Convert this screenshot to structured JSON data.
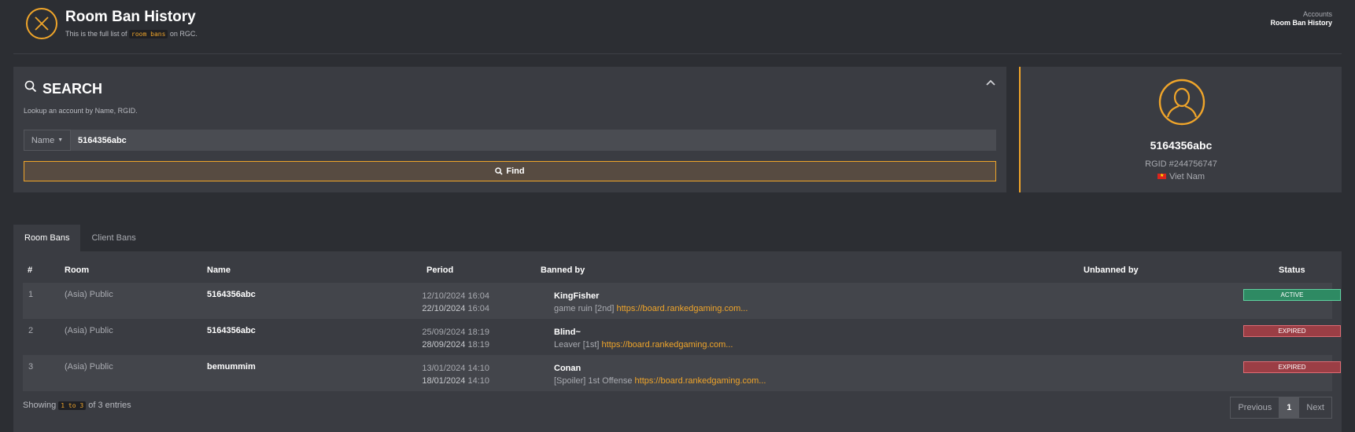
{
  "header": {
    "title": "Room Ban History",
    "subtitle_prefix": "This is the full list of",
    "subtitle_code": "room bans",
    "subtitle_suffix": "on RGC.",
    "breadcrumb_parent": "Accounts",
    "breadcrumb_current": "Room Ban History",
    "icon": "close-circle-icon"
  },
  "search": {
    "title": "SEARCH",
    "hint": "Lookup an account by Name, RGID.",
    "field_selected": "Name",
    "value": "5164356abc",
    "find_label": "Find"
  },
  "profile": {
    "name": "5164356abc",
    "rgid": "RGID #244756747",
    "country": "Viet Nam"
  },
  "tabs": [
    {
      "label": "Room Bans",
      "active": true
    },
    {
      "label": "Client Bans",
      "active": false
    }
  ],
  "table": {
    "headers": {
      "num": "#",
      "room": "Room",
      "name": "Name",
      "period": "Period",
      "banned_by": "Banned by",
      "unbanned_by": "Unbanned by",
      "status": "Status"
    },
    "rows": [
      {
        "num": "1",
        "room": "(Asia) Public",
        "name": "5164356abc",
        "start_date": "12/10/2024",
        "start_time": "16:04",
        "end_date": "22/10/2024",
        "end_time": "16:04",
        "banned_by": "KingFisher",
        "reason": "game ruin [2nd]",
        "link": "https://board.rankedgaming.com...",
        "status": "ACTIVE"
      },
      {
        "num": "2",
        "room": "(Asia) Public",
        "name": "5164356abc",
        "start_date": "25/09/2024",
        "start_time": "18:19",
        "end_date": "28/09/2024",
        "end_time": "18:19",
        "banned_by": "Blind~",
        "reason": "Leaver [1st]",
        "link": "https://board.rankedgaming.com...",
        "status": "EXPIRED"
      },
      {
        "num": "3",
        "room": "(Asia) Public",
        "name": "bemummim",
        "start_date": "13/01/2024",
        "start_time": "14:10",
        "end_date": "18/01/2024",
        "end_time": "14:10",
        "banned_by": "Conan",
        "reason": "[Spoiler] 1st Offense",
        "link": "https://board.rankedgaming.com...",
        "status": "EXPIRED"
      }
    ],
    "footer_prefix": "Showing",
    "footer_range": "1 to 3",
    "footer_suffix": "of 3 entries"
  },
  "pagination": {
    "previous": "Previous",
    "current": "1",
    "next": "Next"
  },
  "colors": {
    "accent": "#f0a52a",
    "active": "#2e8a63",
    "expired": "#9b3e45"
  }
}
